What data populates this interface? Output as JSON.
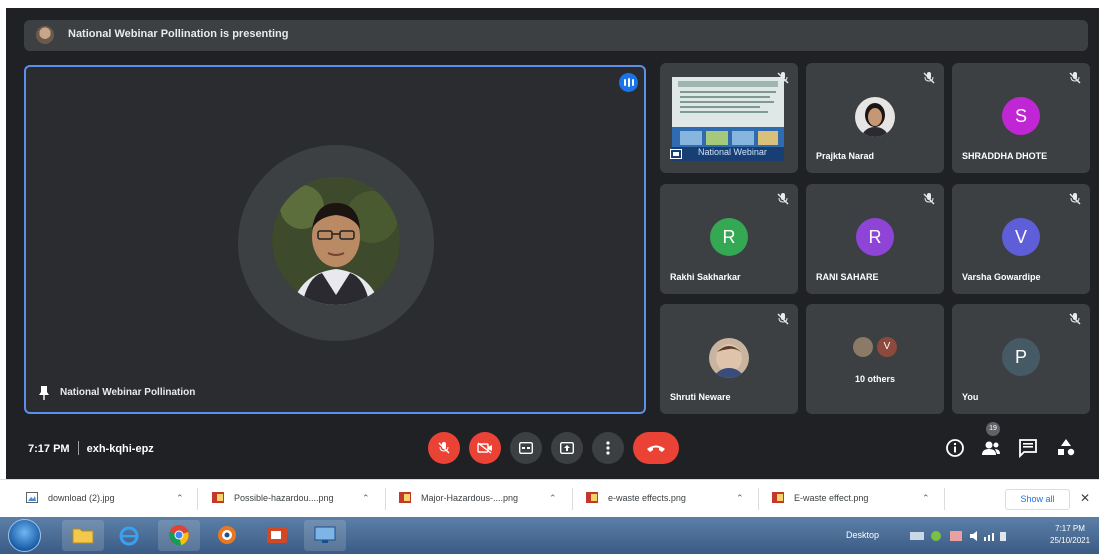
{
  "banner": {
    "text": "National Webinar Pollination is presenting"
  },
  "main_tile": {
    "name": "National Webinar Pollination"
  },
  "tiles": [
    {
      "name": "National Webinar",
      "kind": "slide"
    },
    {
      "name": "Prajkta Narad",
      "kind": "photo"
    },
    {
      "name": "SHRADDHA DHOTE",
      "letter": "S",
      "color": "#c026d3"
    },
    {
      "name": "Rakhi Sakharkar",
      "letter": "R",
      "color": "#34a853"
    },
    {
      "name": "RANI SAHARE",
      "letter": "R",
      "color": "#8e44d6"
    },
    {
      "name": "Varsha Gowardipe",
      "letter": "V",
      "color": "#5e5ed8"
    },
    {
      "name": "Shruti Neware",
      "kind": "photo"
    },
    {
      "name": "10 others",
      "letter": "V",
      "color": "#8d4a3c"
    },
    {
      "name": "You",
      "letter": "P",
      "color": "#455a64"
    }
  ],
  "meeting": {
    "time": "7:17 PM",
    "code": "exh-kqhi-epz"
  },
  "people_count": "19",
  "downloads": [
    {
      "name": "download (2).jpg",
      "type": "jpg"
    },
    {
      "name": "Possible-hazardou....png",
      "type": "png"
    },
    {
      "name": "Major-Hazardous-....png",
      "type": "png"
    },
    {
      "name": "e-waste effects.png",
      "type": "png"
    },
    {
      "name": "E-waste effect.png",
      "type": "png"
    }
  ],
  "downloads_show_all": "Show all",
  "taskbar": {
    "desktop_label": "Desktop",
    "clock_time": "7:17 PM",
    "clock_date": "25/10/2021"
  },
  "colors": {
    "meet_bg": "#202124",
    "tile_bg": "#3c4043",
    "red": "#ea4335",
    "accent": "#1a73e8"
  },
  "icons": [
    "mic-off-icon",
    "camera-off-icon",
    "captions-icon",
    "present-icon",
    "more-icon",
    "end-call-icon",
    "info-icon",
    "people-icon",
    "chat-icon",
    "activities-icon",
    "pin-icon"
  ]
}
